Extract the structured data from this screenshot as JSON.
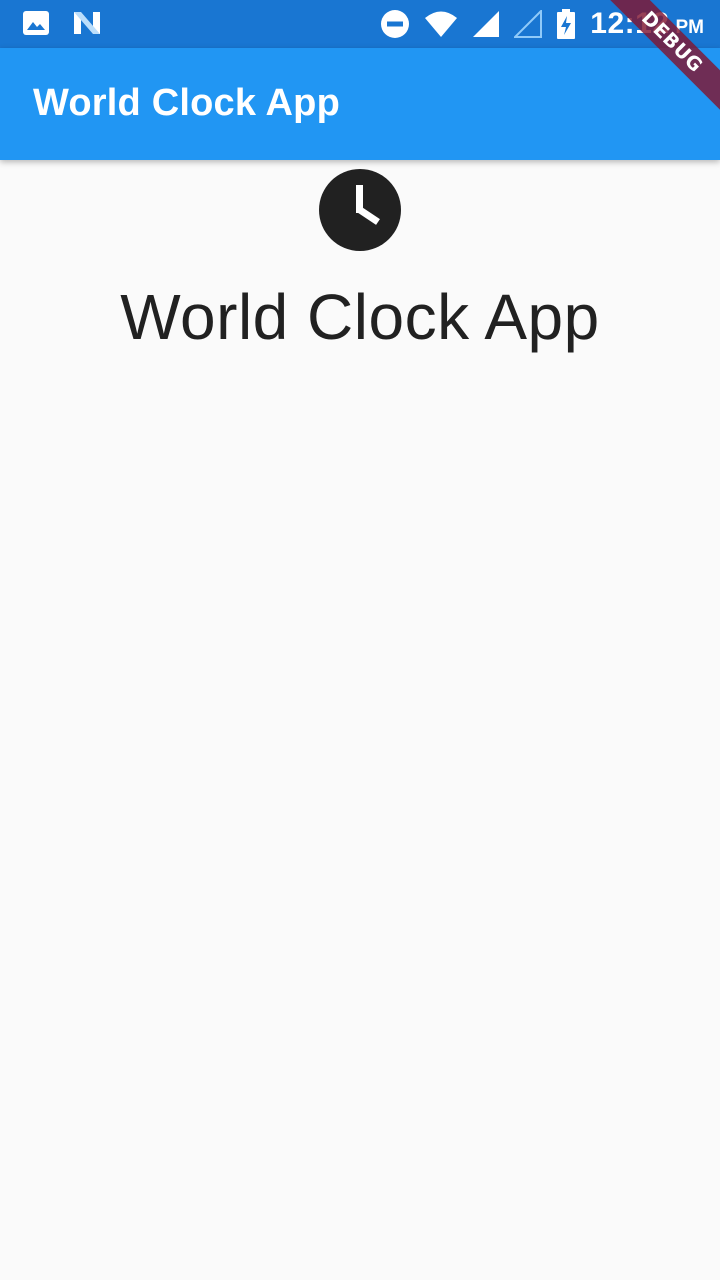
{
  "status_bar": {
    "time": "12:12",
    "ampm": "PM",
    "icons": [
      "gallery-icon",
      "n-logo-icon",
      "do-not-disturb-icon",
      "wifi-icon",
      "signal-icon",
      "signal-empty-icon",
      "battery-charging-icon"
    ]
  },
  "app_bar": {
    "title": "World Clock App"
  },
  "main": {
    "icon": "clock-icon",
    "title": "World Clock App"
  },
  "debug_banner": {
    "label": "DEBUG"
  },
  "colors": {
    "status_bar": "#1976d2",
    "app_bar": "#2196f3",
    "background": "#fafafa",
    "text": "#212121",
    "debug": "#801632"
  }
}
